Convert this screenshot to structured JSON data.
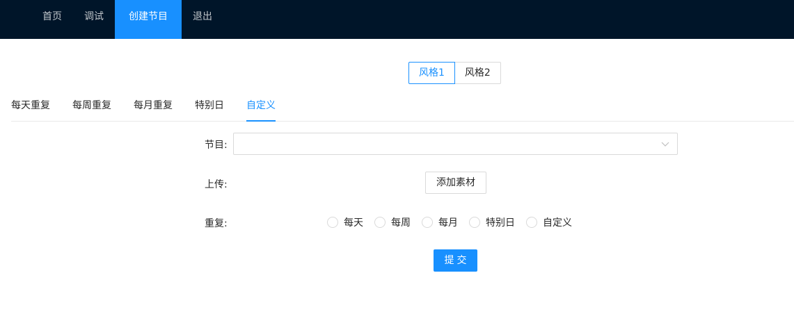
{
  "nav": {
    "items": [
      {
        "label": "首页"
      },
      {
        "label": "调试"
      },
      {
        "label": "创建节目",
        "active": true
      },
      {
        "label": "退出"
      }
    ]
  },
  "style_switch": {
    "options": [
      "风格1",
      "风格2"
    ],
    "selected": "风格1"
  },
  "tabs": {
    "items": [
      "每天重复",
      "每周重复",
      "每月重复",
      "特别日",
      "自定义"
    ],
    "active": "自定义"
  },
  "form": {
    "program_label": "节目:",
    "program_value": "",
    "upload_label": "上传:",
    "upload_button": "添加素材",
    "repeat_label": "重复:",
    "repeat_options": [
      "每天",
      "每周",
      "每月",
      "特别日",
      "自定义"
    ],
    "repeat_selected": null,
    "submit_label": "提交"
  },
  "colors": {
    "nav_bg": "#001529",
    "primary": "#1890ff",
    "border": "#d9d9d9"
  }
}
